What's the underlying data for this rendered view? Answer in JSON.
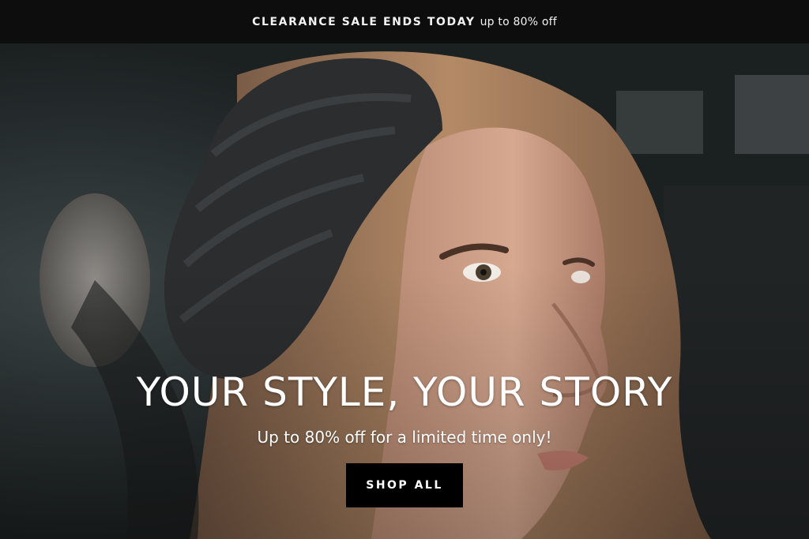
{
  "announcement": {
    "headline": "CLEARANCE SALE ENDS TODAY",
    "detail": "up to 80% off"
  },
  "hero": {
    "image_subject": "woman in dark knit beanie with pom-pom",
    "title": "YOUR STYLE, YOUR STORY",
    "subtitle": "Up to 80% off for a limited time only!",
    "cta_label": "SHOP ALL"
  },
  "colors": {
    "bar_background": "#0d0d0d",
    "button_background": "#000000",
    "text": "#ffffff"
  }
}
